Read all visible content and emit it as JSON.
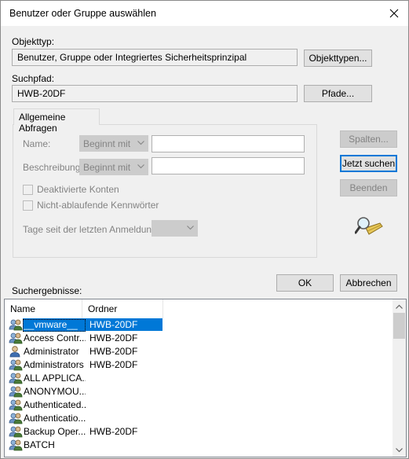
{
  "window": {
    "title": "Benutzer oder Gruppe auswählen"
  },
  "object_type": {
    "label": "Objekttyp:",
    "value": "Benutzer, Gruppe oder Integriertes Sicherheitsprinzipal",
    "button": "Objekttypen..."
  },
  "search_path": {
    "label": "Suchpfad:",
    "value": "HWB-20DF",
    "button": "Pfade..."
  },
  "tab": {
    "label": "Allgemeine Abfragen"
  },
  "query": {
    "name_label": "Name:",
    "name_mode": "Beginnt mit",
    "description_label": "Beschreibung:",
    "description_mode": "Beginnt mit",
    "disabled_accounts": "Deaktivierte Konten",
    "non_expiring_passwords": "Nicht-ablaufende Kennwörter",
    "days_since_login": "Tage seit der letzten Anmeldung:"
  },
  "side_buttons": {
    "columns": "Spalten...",
    "search_now": "Jetzt suchen",
    "stop": "Beenden"
  },
  "dialog_buttons": {
    "ok": "OK",
    "cancel": "Abbrechen"
  },
  "results": {
    "label": "Suchergebnisse:",
    "columns": [
      "Name",
      "Ordner"
    ],
    "rows": [
      {
        "name": "__vmware__",
        "folder": "HWB-20DF",
        "icon": "group-icon",
        "selected": true
      },
      {
        "name": "Access Contr...",
        "folder": "HWB-20DF",
        "icon": "group-icon"
      },
      {
        "name": "Administrator",
        "folder": "HWB-20DF",
        "icon": "user-icon"
      },
      {
        "name": "Administrators",
        "folder": "HWB-20DF",
        "icon": "group-icon"
      },
      {
        "name": "ALL APPLICA...",
        "folder": "",
        "icon": "group-icon"
      },
      {
        "name": "ANONYMOU...",
        "folder": "",
        "icon": "group-icon"
      },
      {
        "name": "Authenticated...",
        "folder": "",
        "icon": "group-icon"
      },
      {
        "name": "Authenticatio...",
        "folder": "",
        "icon": "group-icon"
      },
      {
        "name": "Backup Oper...",
        "folder": "HWB-20DF",
        "icon": "group-icon"
      },
      {
        "name": "BATCH",
        "folder": "",
        "icon": "group-icon"
      }
    ]
  },
  "colors": {
    "accent": "#0078d7",
    "disabled_text": "#838383"
  }
}
